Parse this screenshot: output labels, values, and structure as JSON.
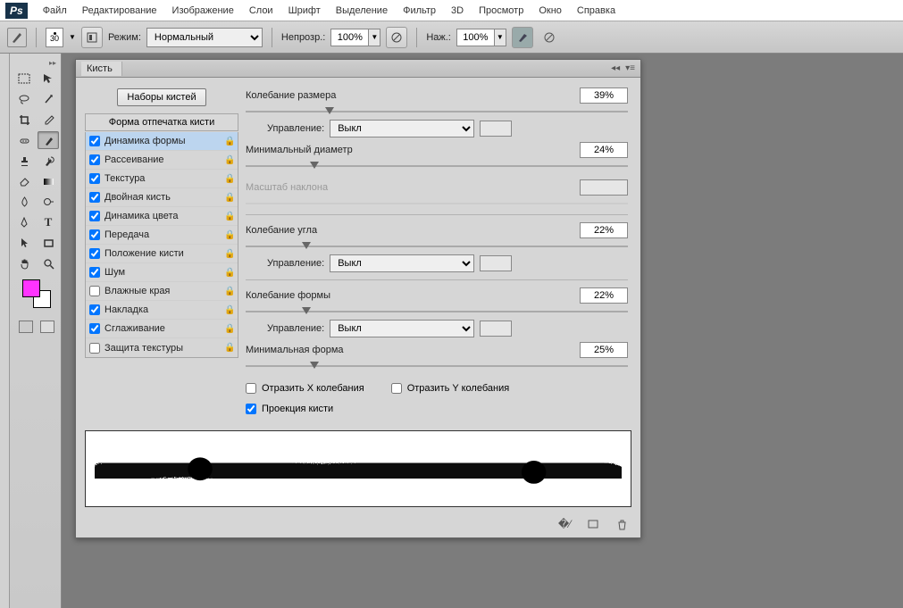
{
  "menu": {
    "logo": "Ps",
    "items": [
      "Файл",
      "Редактирование",
      "Изображение",
      "Слои",
      "Шрифт",
      "Выделение",
      "Фильтр",
      "3D",
      "Просмотр",
      "Окно",
      "Справка"
    ]
  },
  "options": {
    "brush_size": "30",
    "mode_label": "Режим:",
    "mode_value": "Нормальный",
    "opacity_label": "Непрозр.:",
    "opacity_value": "100%",
    "flow_label": "Наж.:",
    "flow_value": "100%"
  },
  "tools": [
    "move",
    "rect-marquee",
    "lasso",
    "magic-wand",
    "crop",
    "eyedropper",
    "healing",
    "brush",
    "stamp",
    "history-brush",
    "eraser",
    "gradient",
    "blur",
    "dodge",
    "pen",
    "text",
    "path-select",
    "shape",
    "hand",
    "zoom"
  ],
  "panel": {
    "title": "Кисть",
    "presets_btn": "Наборы кистей",
    "tip_header": "Форма отпечатка кисти",
    "options": [
      {
        "label": "Динамика формы",
        "checked": true,
        "lock": true,
        "sel": true
      },
      {
        "label": "Рассеивание",
        "checked": true,
        "lock": true
      },
      {
        "label": "Текстура",
        "checked": true,
        "lock": true
      },
      {
        "label": "Двойная кисть",
        "checked": true,
        "lock": true
      },
      {
        "label": "Динамика цвета",
        "checked": true,
        "lock": true
      },
      {
        "label": "Передача",
        "checked": true,
        "lock": true
      },
      {
        "label": "Положение кисти",
        "checked": true,
        "lock": true
      },
      {
        "label": "Шум",
        "checked": true,
        "lock": true
      },
      {
        "label": "Влажные края",
        "checked": false,
        "lock": true
      },
      {
        "label": "Накладка",
        "checked": true,
        "lock": true
      },
      {
        "label": "Сглаживание",
        "checked": true,
        "lock": true
      },
      {
        "label": "Защита текстуры",
        "checked": false,
        "lock": true
      }
    ],
    "params": {
      "size_jitter": {
        "label": "Колебание размера",
        "value": "39%",
        "pos": 22
      },
      "control1": {
        "label": "Управление:",
        "value": "Выкл"
      },
      "min_diameter": {
        "label": "Минимальный диаметр",
        "value": "24%",
        "pos": 18
      },
      "tilt_scale": {
        "label": "Масштаб наклона",
        "value": "",
        "disabled": true
      },
      "angle_jitter": {
        "label": "Колебание угла",
        "value": "22%",
        "pos": 16
      },
      "control2": {
        "label": "Управление:",
        "value": "Выкл"
      },
      "round_jitter": {
        "label": "Колебание формы",
        "value": "22%",
        "pos": 16
      },
      "control3": {
        "label": "Управление:",
        "value": "Выкл"
      },
      "min_round": {
        "label": "Минимальная форма",
        "value": "25%",
        "pos": 18
      },
      "flip_x": {
        "label": "Отразить X колебания",
        "checked": false
      },
      "flip_y": {
        "label": "Отразить Y колебания",
        "checked": false
      },
      "projection": {
        "label": "Проекция кисти",
        "checked": true
      }
    }
  }
}
